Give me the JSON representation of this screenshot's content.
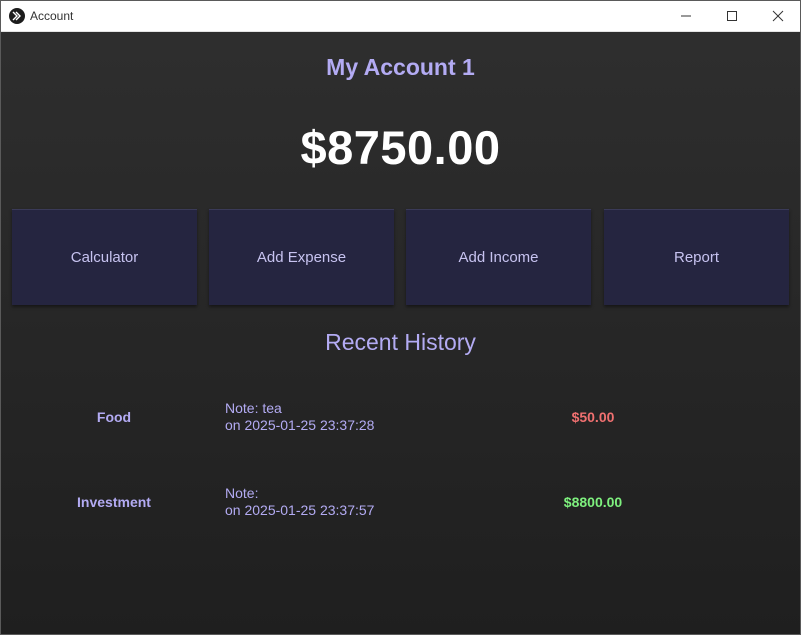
{
  "window": {
    "title": "Account"
  },
  "account": {
    "name": "My Account 1",
    "balance": "$8750.00"
  },
  "actions": {
    "calculator": "Calculator",
    "add_expense": "Add Expense",
    "add_income": "Add Income",
    "report": "Report"
  },
  "history": {
    "title": "Recent History",
    "items": [
      {
        "category": "Food",
        "note": "Note: tea",
        "timestamp": "on 2025-01-25 23:37:28",
        "amount": "$50.00",
        "type": "expense",
        "color": "#f07070"
      },
      {
        "category": "Investment",
        "note": "Note: ",
        "timestamp": "on 2025-01-25 23:37:57",
        "amount": "$8800.00",
        "type": "income",
        "color": "#7ef07e"
      }
    ]
  },
  "colors": {
    "accent": "#b3abf3",
    "button_bg": "#252540",
    "expense": "#f07070",
    "income": "#7ef07e"
  },
  "icons": {
    "app": "kivy-logo-icon",
    "minimize": "minimize-icon",
    "maximize": "maximize-icon",
    "close": "close-icon"
  }
}
